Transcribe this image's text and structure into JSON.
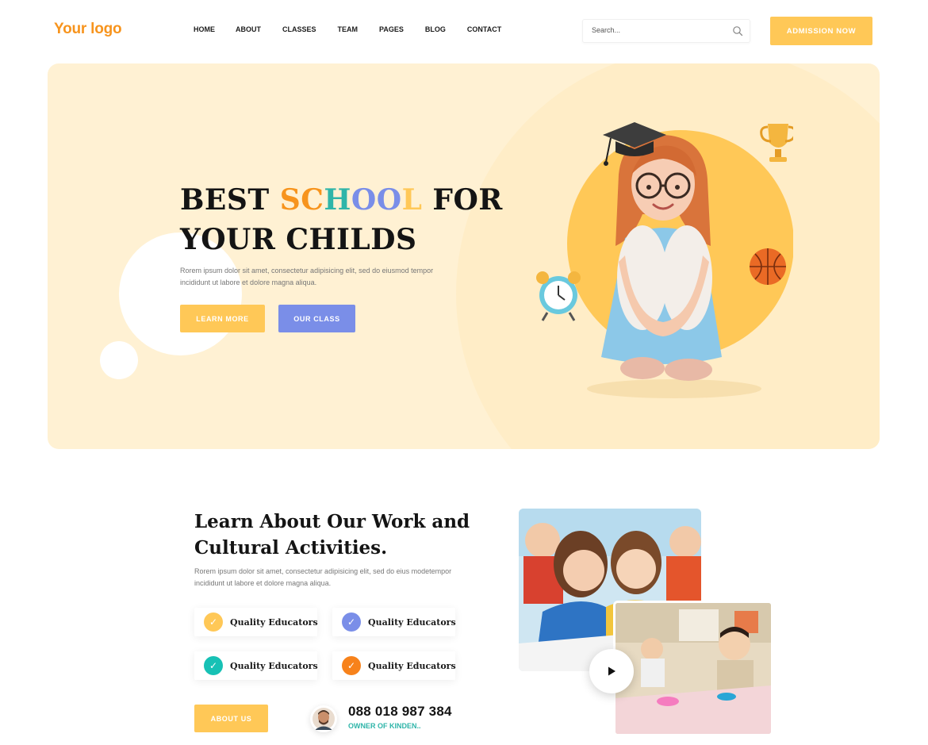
{
  "header": {
    "logo": "Your logo",
    "nav": [
      {
        "label": "HOME",
        "active": true
      },
      {
        "label": "ABOUT"
      },
      {
        "label": "CLASSES"
      },
      {
        "label": "TEAM"
      },
      {
        "label": "PAGES"
      },
      {
        "label": "BLOG"
      },
      {
        "label": "CONTACT"
      }
    ],
    "search_placeholder": "Search...",
    "search_icon": "search-icon",
    "cta_label": "ADMISSION NOW"
  },
  "hero": {
    "title_part1": "BEST ",
    "title_highlight": [
      "S",
      "C",
      "H",
      "O",
      "O",
      "L"
    ],
    "title_part2": " FOR",
    "title_line2": "YOUR CHILDS",
    "description": "Rorem ipsum dolor sit amet, consectetur adipisicing elit, sed do eiusmod tempor incididunt ut labore et dolore magna aliqua.",
    "primary_button": "LEARN MORE",
    "secondary_button": "OUR CLASS"
  },
  "about": {
    "title_line1": "Learn About Our Work and",
    "title_line2": "Cultural Activities.",
    "description": "Rorem ipsum dolor sit amet, consectetur adipisicing elit, sed do eius modetempor incididunt ut labore et dolore magna aliqua.",
    "features": [
      {
        "label": "Quality Educators",
        "color": "#ffc857"
      },
      {
        "label": "Quality Educators",
        "color": "#7a8ee8"
      },
      {
        "label": "Quality Educators",
        "color": "#17c1b5"
      },
      {
        "label": "Quality Educators",
        "color": "#f7821b"
      }
    ],
    "button": "ABOUT US",
    "phone": "088 018 987 384",
    "owner_role": "OWNER OF KINDEN.."
  },
  "colors": {
    "accent": "#ffc857",
    "orange": "#f7941d",
    "purple": "#7a8ee8",
    "teal": "#2fb5a9",
    "hero_bg": "#fff1d3"
  }
}
